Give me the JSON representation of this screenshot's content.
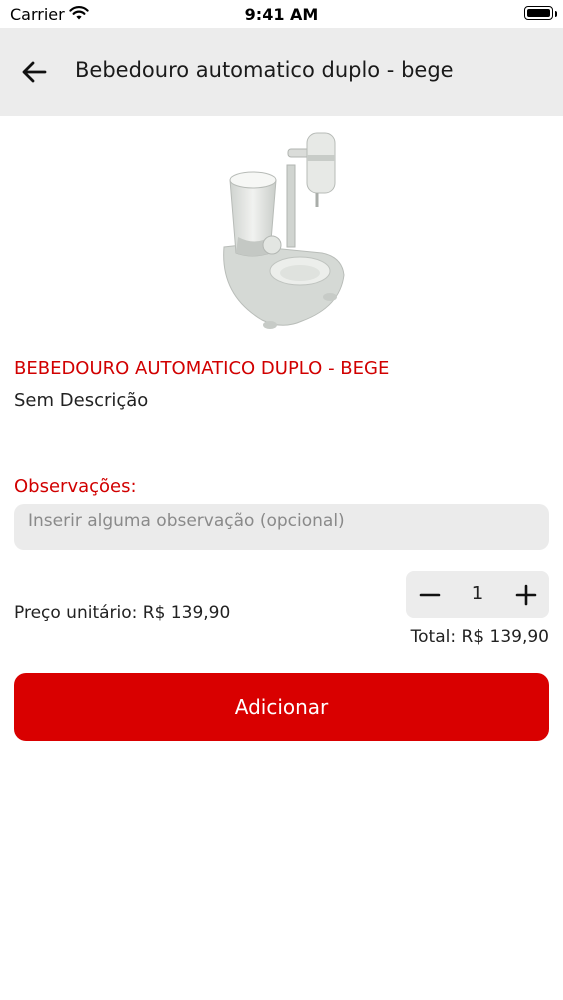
{
  "status_bar": {
    "carrier": "Carrier",
    "time": "9:41 AM",
    "icons": [
      "wifi-icon",
      "battery-icon"
    ]
  },
  "header": {
    "back_icon": "arrow-left-icon",
    "title": "Bebedouro automatico duplo - bege",
    "background": "#ececec"
  },
  "product": {
    "image_icon": "pet-water-fountain-image",
    "name": "BEBEDOURO AUTOMATICO DUPLO - BEGE",
    "description": "Sem Descrição"
  },
  "observations": {
    "label": "Observações:",
    "value": "",
    "placeholder": "Inserir alguma observação (opcional)"
  },
  "pricing": {
    "unit_price": "Preço unitário: R$ 139,90",
    "quantity": "1",
    "minus_icon": "minus-icon",
    "plus_icon": "plus-icon",
    "total": "Total: R$ 139,90"
  },
  "actions": {
    "add_label": "Adicionar"
  },
  "colors": {
    "accent": "#d90000",
    "label_red": "#d10000",
    "field_bg": "#ebebeb"
  }
}
